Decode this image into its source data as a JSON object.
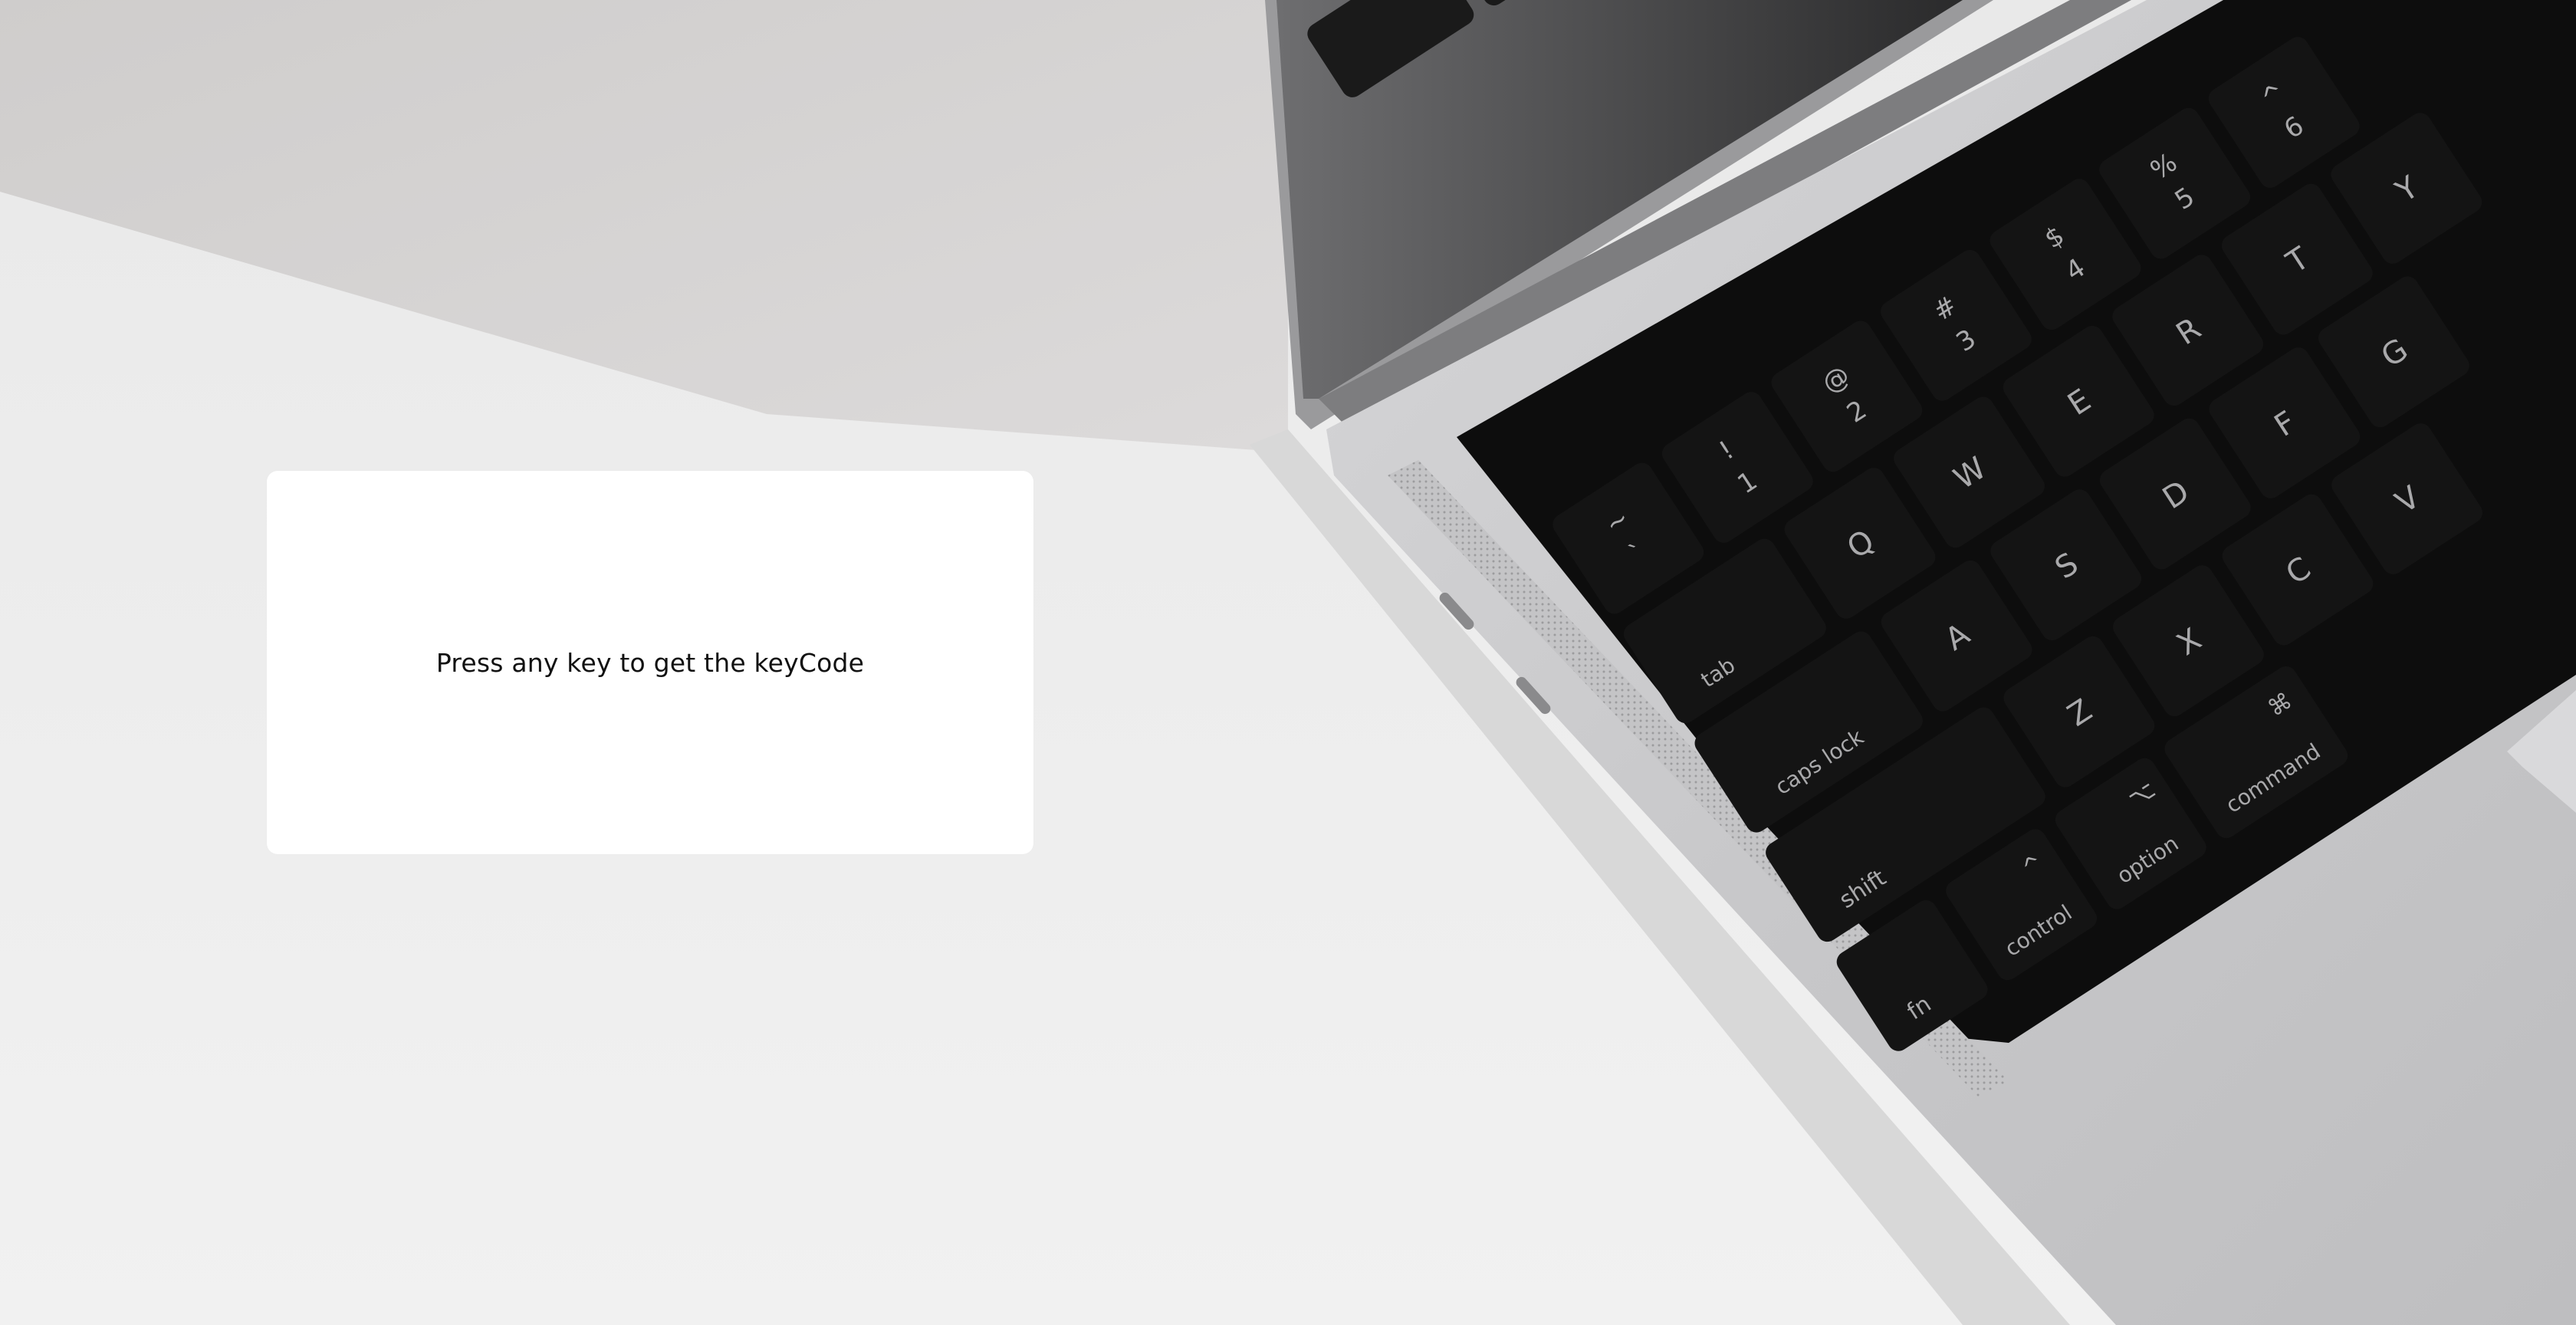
{
  "prompt": {
    "text": "Press any key to get the keyCode"
  },
  "background": {
    "desk_color": "#ececec",
    "shadow_color": "#d2d0cf",
    "laptop_body_color": "#c9c9cb",
    "key_color": "#121212",
    "key_label_color": "#a9a9ab"
  },
  "keyboard": {
    "number_row": [
      {
        "shift": "~",
        "main": "`"
      },
      {
        "shift": "!",
        "main": "1"
      },
      {
        "shift": "@",
        "main": "2"
      },
      {
        "shift": "#",
        "main": "3"
      },
      {
        "shift": "$",
        "main": "4"
      },
      {
        "shift": "%",
        "main": "5"
      },
      {
        "shift": "^",
        "main": "6"
      }
    ],
    "top_row": [
      "tab",
      "Q",
      "W",
      "E",
      "R",
      "T",
      "Y"
    ],
    "home_row": [
      "caps lock",
      "A",
      "S",
      "D",
      "F",
      "G"
    ],
    "bottom_row": [
      "shift",
      "Z",
      "X",
      "C",
      "V"
    ],
    "modifier_row": [
      "fn",
      "control",
      "option",
      "command"
    ],
    "modifier_symbols": {
      "control": "^",
      "option": "⌥",
      "command": "⌘"
    }
  }
}
